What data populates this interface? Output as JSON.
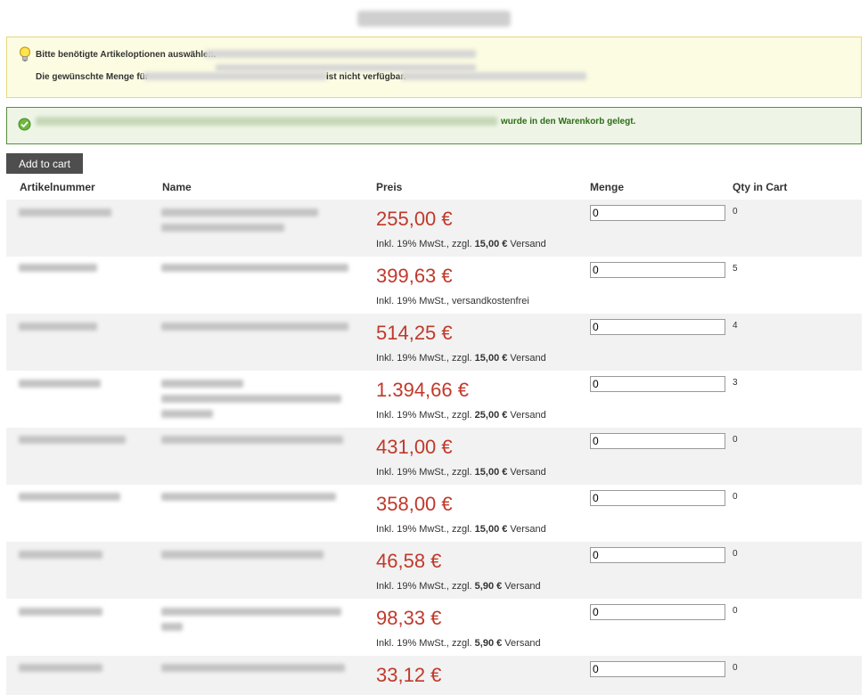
{
  "notices": {
    "warning": {
      "line1": "Bitte benötigte Artikeloptionen auswählen.",
      "line2_prefix": "Die gewünschte Menge für",
      "line2_suffix": "ist nicht verfügbar."
    },
    "success": {
      "suffix": "wurde in den Warenkorb gelegt."
    }
  },
  "toolbar": {
    "add_to_cart_label": "Add to cart"
  },
  "table": {
    "headers": {
      "sku": "Artikelnummer",
      "name": "Name",
      "price": "Preis",
      "qty": "Menge",
      "in_cart": "Qty in Cart"
    },
    "rows": [
      {
        "price": "255,00 €",
        "tax": "Inkl. 19% MwSt., zzgl. ",
        "ship_amount": "15,00 €",
        "ship_suffix": " Versand",
        "qty": "0",
        "in_cart": "0"
      },
      {
        "price": "399,63 €",
        "tax": "Inkl. 19% MwSt., versandkostenfrei",
        "ship_amount": "",
        "ship_suffix": "",
        "qty": "0",
        "in_cart": "5"
      },
      {
        "price": "514,25 €",
        "tax": "Inkl. 19% MwSt., zzgl. ",
        "ship_amount": "15,00 €",
        "ship_suffix": " Versand",
        "qty": "0",
        "in_cart": "4"
      },
      {
        "price": "1.394,66 €",
        "tax": "Inkl. 19% MwSt., zzgl. ",
        "ship_amount": "25,00 €",
        "ship_suffix": " Versand",
        "qty": "0",
        "in_cart": "3"
      },
      {
        "price": "431,00 €",
        "tax": "Inkl. 19% MwSt., zzgl. ",
        "ship_amount": "15,00 €",
        "ship_suffix": " Versand",
        "qty": "0",
        "in_cart": "0"
      },
      {
        "price": "358,00 €",
        "tax": "Inkl. 19% MwSt., zzgl. ",
        "ship_amount": "15,00 €",
        "ship_suffix": " Versand",
        "qty": "0",
        "in_cart": "0"
      },
      {
        "price": "46,58 €",
        "tax": "Inkl. 19% MwSt., zzgl. ",
        "ship_amount": "5,90 €",
        "ship_suffix": " Versand",
        "qty": "0",
        "in_cart": "0"
      },
      {
        "price": "98,33 €",
        "tax": "Inkl. 19% MwSt., zzgl. ",
        "ship_amount": "5,90 €",
        "ship_suffix": " Versand",
        "qty": "0",
        "in_cart": "0"
      },
      {
        "price": "33,12 €",
        "tax": "",
        "ship_amount": "",
        "ship_suffix": "",
        "qty": "0",
        "in_cart": "0"
      }
    ]
  },
  "icons": {
    "warning": "lightbulb-icon",
    "success": "check-circle-icon"
  },
  "colors": {
    "price": "#c0392b",
    "success_text": "#2d6d16",
    "button_bg": "#4e4e4e"
  }
}
